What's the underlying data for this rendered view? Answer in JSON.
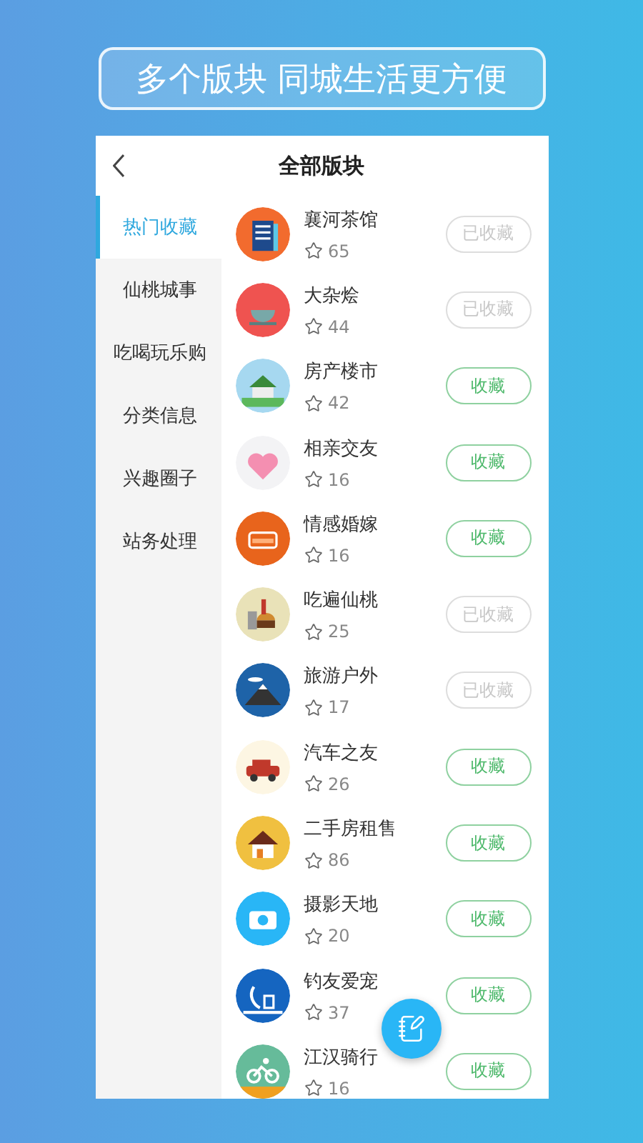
{
  "banner": {
    "title": "多个版块 同城生活更方便"
  },
  "header": {
    "title": "全部版块"
  },
  "sidebar": {
    "items": [
      {
        "label": "热门收藏",
        "selected": true
      },
      {
        "label": "仙桃城事",
        "selected": false
      },
      {
        "label": "吃喝玩乐购",
        "selected": false
      },
      {
        "label": "分类信息",
        "selected": false
      },
      {
        "label": "兴趣圈子",
        "selected": false
      },
      {
        "label": "站务处理",
        "selected": false
      }
    ]
  },
  "boards": [
    {
      "name": "襄河茶馆",
      "count": "65",
      "button": "已收藏",
      "collected": true
    },
    {
      "name": "大杂烩",
      "count": "44",
      "button": "已收藏",
      "collected": true
    },
    {
      "name": "房产楼市",
      "count": "42",
      "button": "收藏",
      "collected": false
    },
    {
      "name": "相亲交友",
      "count": "16",
      "button": "收藏",
      "collected": false
    },
    {
      "name": "情感婚嫁",
      "count": "16",
      "button": "收藏",
      "collected": false
    },
    {
      "name": "吃遍仙桃",
      "count": "25",
      "button": "已收藏",
      "collected": true
    },
    {
      "name": "旅游户外",
      "count": "17",
      "button": "已收藏",
      "collected": true
    },
    {
      "name": "汽车之友",
      "count": "26",
      "button": "收藏",
      "collected": false
    },
    {
      "name": "二手房租售",
      "count": "86",
      "button": "收藏",
      "collected": false
    },
    {
      "name": "摄影天地",
      "count": "20",
      "button": "收藏",
      "collected": false
    },
    {
      "name": "钓友爱宠",
      "count": "37",
      "button": "收藏",
      "collected": false
    },
    {
      "name": "江汉骑行",
      "count": "16",
      "button": "收藏",
      "collected": false
    }
  ]
}
